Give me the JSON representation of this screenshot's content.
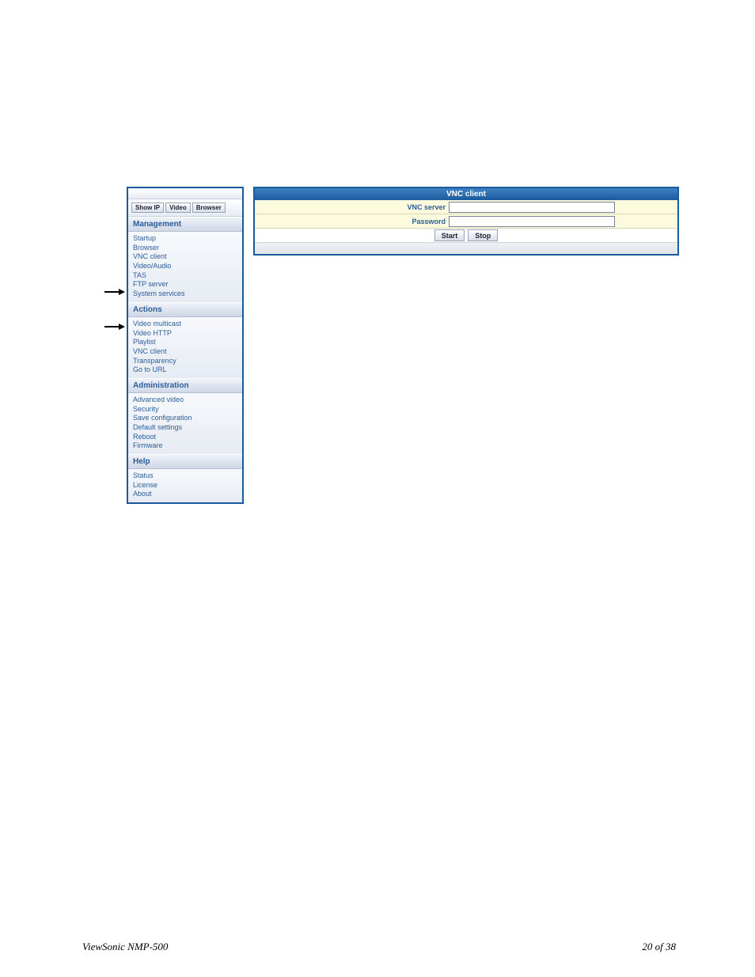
{
  "footer": {
    "left": "ViewSonic NMP-500",
    "right": "20 of  38"
  },
  "sidebar": {
    "buttons": {
      "show_ip": "Show IP",
      "video": "Video",
      "browser": "Browser"
    },
    "sections": [
      {
        "title": "Management",
        "items": [
          "Startup",
          "Browser",
          "VNC client",
          "Video/Audio",
          "TAS",
          "FTP server",
          "System services"
        ]
      },
      {
        "title": "Actions",
        "items": [
          "Video multicast",
          "Video HTTP",
          "Playlist",
          "VNC client",
          "Transparency",
          "Go to URL"
        ]
      },
      {
        "title": "Administration",
        "items": [
          "Advanced video",
          "Security",
          "Save configuration",
          "Default settings",
          "Reboot",
          "Firmware"
        ]
      },
      {
        "title": "Help",
        "items": [
          "Status",
          "License",
          "About"
        ]
      }
    ]
  },
  "content": {
    "title": "VNC client",
    "rows": {
      "server_label": "VNC server",
      "password_label": "Password"
    },
    "buttons": {
      "start": "Start",
      "stop": "Stop"
    }
  }
}
